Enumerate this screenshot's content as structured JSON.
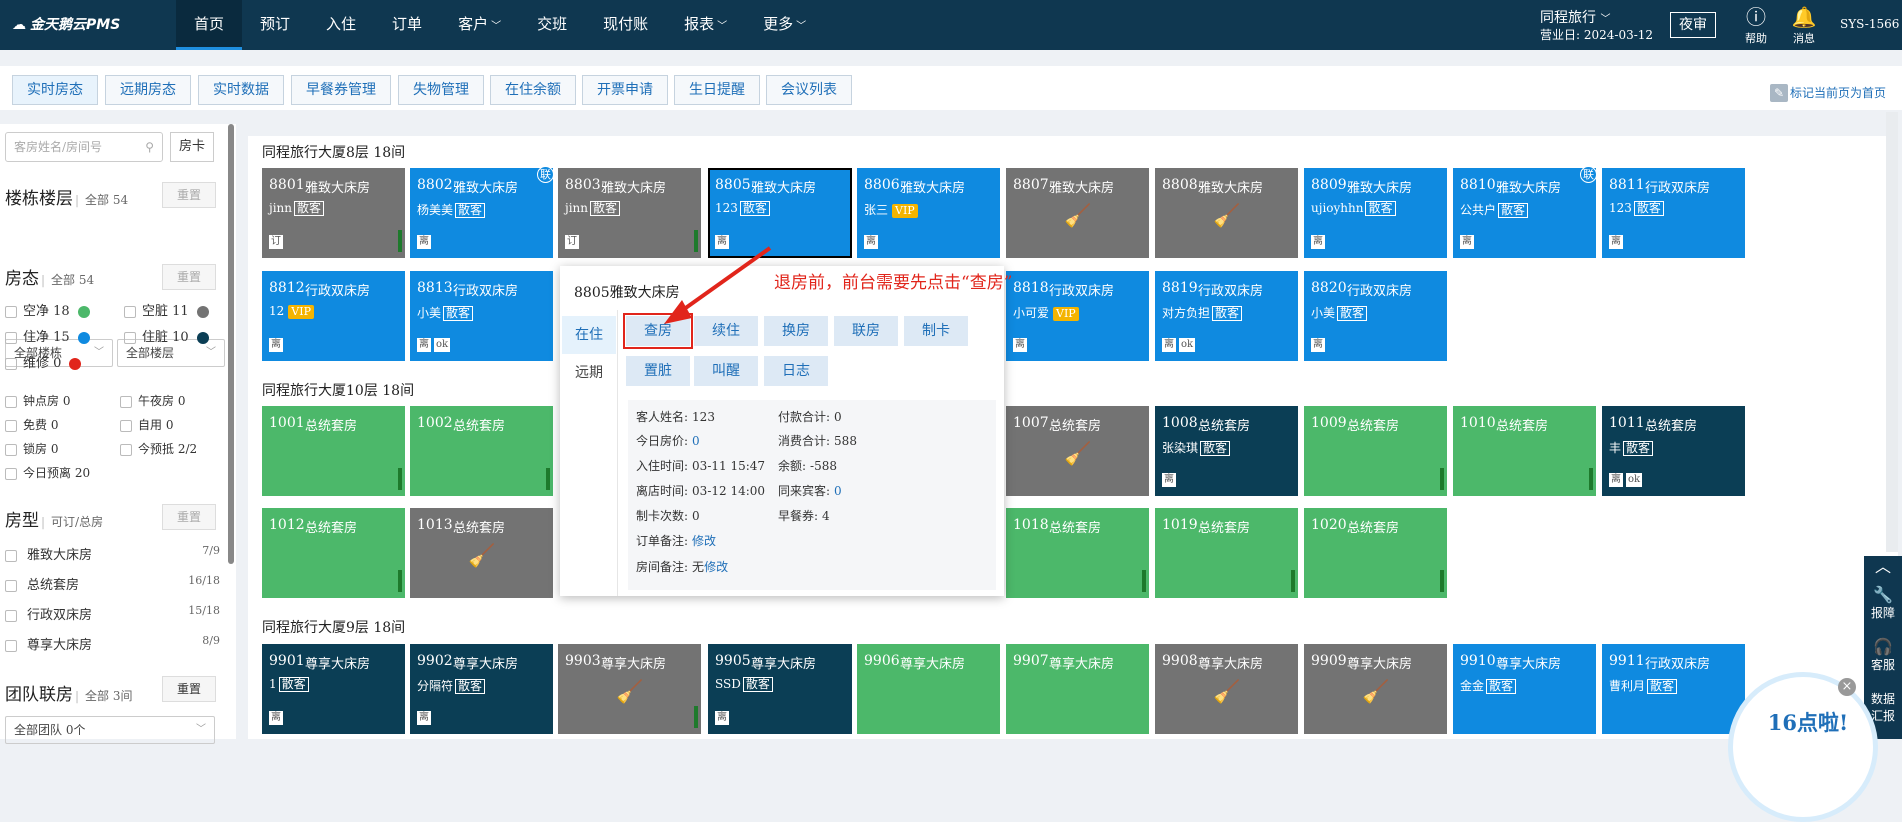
{
  "app": {
    "logo": "金天鹅云PMS"
  },
  "nav": {
    "items": [
      {
        "label": "首页",
        "dropdown": false
      },
      {
        "label": "预订",
        "dropdown": false
      },
      {
        "label": "入住",
        "dropdown": false
      },
      {
        "label": "订单",
        "dropdown": false
      },
      {
        "label": "客户",
        "dropdown": true
      },
      {
        "label": "交班",
        "dropdown": false
      },
      {
        "label": "现付账",
        "dropdown": false
      },
      {
        "label": "报表",
        "dropdown": true
      },
      {
        "label": "更多",
        "dropdown": true
      }
    ],
    "active": 0
  },
  "header": {
    "hotel": "同程旅行",
    "bizdate_label": "营业日:",
    "bizdate": "2024-03-12",
    "night_btn": "夜审",
    "help": "帮助",
    "msg": "消息",
    "sysid": "SYS-1566"
  },
  "tabs": [
    "实时房态",
    "远期房态",
    "实时数据",
    "早餐券管理",
    "失物管理",
    "在住余额",
    "开票申请",
    "生日提醒",
    "会议列表"
  ],
  "mark_home": "标记当前页为首页",
  "sidebar": {
    "search_placeholder": "客房姓名/房间号",
    "card_btn": "房卡",
    "bldg_title": "楼栋楼层",
    "bldg_all": "全部 54",
    "reset": "重置",
    "sel_bldg": "全部楼栋",
    "sel_floor": "全部楼层",
    "status_title": "房态",
    "status_all": "全部 54",
    "statuses": [
      {
        "label": "空净 18",
        "color": "#4cb86a"
      },
      {
        "label": "空脏 11",
        "color": "#737373"
      },
      {
        "label": "住净 15",
        "color": "#0f8ae0"
      },
      {
        "label": "住脏 10",
        "color": "#0b3e55"
      },
      {
        "label": "维修 0",
        "color": "#e1251b"
      }
    ],
    "flags": [
      "钟点房 0",
      "午夜房 0",
      "免费 0",
      "自用 0",
      "锁房 0",
      "今预抵 2/2",
      "今日预离 20"
    ],
    "rt_title": "房型",
    "rt_sub": "可订/总房",
    "roomtypes": [
      {
        "label": "雅致大床房",
        "count": "7/9"
      },
      {
        "label": "总统套房",
        "count": "16/18"
      },
      {
        "label": "行政双床房",
        "count": "15/18"
      },
      {
        "label": "尊享大床房",
        "count": "8/9"
      }
    ],
    "team_title": "团队联房",
    "team_all": "全部 3间",
    "team_sel": "全部团队 0个"
  },
  "floors": [
    {
      "title": "同程旅行大厦8层 18间"
    },
    {
      "title": "同程旅行大厦10层 18间"
    },
    {
      "title": "同程旅行大厦9层 18间"
    }
  ],
  "rooms": {
    "r8801": {
      "num": "8801",
      "type": "雅致大床房",
      "guest": "jinn",
      "gtag": "散客",
      "tag": "订"
    },
    "r8802": {
      "num": "8802",
      "type": "雅致大床房",
      "guest": "杨美美",
      "gtag": "散客",
      "tag": "离",
      "lian": "联"
    },
    "r8803": {
      "num": "8803",
      "type": "雅致大床房",
      "guest": "jinn",
      "gtag": "散客",
      "tag": "订"
    },
    "r8805": {
      "num": "8805",
      "type": "雅致大床房",
      "guest": "123",
      "gtag": "散客",
      "tag": "离"
    },
    "r8806": {
      "num": "8806",
      "type": "雅致大床房",
      "guest": "张三",
      "vip": "VIP",
      "tag": "离"
    },
    "r8807": {
      "num": "8807",
      "type": "雅致大床房"
    },
    "r8808": {
      "num": "8808",
      "type": "雅致大床房"
    },
    "r8809": {
      "num": "8809",
      "type": "雅致大床房",
      "guest": "ujioyhhn",
      "gtag": "散客",
      "tag": "离"
    },
    "r8810": {
      "num": "8810",
      "type": "雅致大床房",
      "guest": "公共户",
      "gtag": "散客",
      "tag": "离",
      "lian": "联"
    },
    "r8811": {
      "num": "8811",
      "type": "行政双床房",
      "guest": "123",
      "gtag": "散客",
      "tag": "离"
    },
    "r8812": {
      "num": "8812",
      "type": "行政双床房",
      "guest": "12",
      "vip": "VIP",
      "tag": "离"
    },
    "r8813": {
      "num": "8813",
      "type": "行政双床房",
      "guest": "小美",
      "gtag": "散客",
      "tag": "离",
      "ok": "ok"
    },
    "r8818": {
      "num": "8818",
      "type": "行政双床房",
      "guest": "小可爱",
      "vip": "VIP",
      "tag": "离"
    },
    "r8819": {
      "num": "8819",
      "type": "行政双床房",
      "guest": "对方负担",
      "gtag": "散客",
      "tag": "离",
      "ok": "ok"
    },
    "r8820": {
      "num": "8820",
      "type": "行政双床房",
      "guest": "小美",
      "gtag": "散客",
      "tag": "离"
    },
    "r1001": {
      "num": "1001",
      "type": "总统套房"
    },
    "r1002": {
      "num": "1002",
      "type": "总统套房"
    },
    "r1007": {
      "num": "1007",
      "type": "总统套房"
    },
    "r1008": {
      "num": "1008",
      "type": "总统套房",
      "guest": "张染琪",
      "gtag": "散客",
      "tag": "离"
    },
    "r1009": {
      "num": "1009",
      "type": "总统套房"
    },
    "r1010": {
      "num": "1010",
      "type": "总统套房"
    },
    "r1011": {
      "num": "1011",
      "type": "总统套房",
      "guest": "丰",
      "gtag": "散客",
      "tag": "离",
      "ok": "ok"
    },
    "r1012": {
      "num": "1012",
      "type": "总统套房"
    },
    "r1013": {
      "num": "1013",
      "type": "总统套房"
    },
    "r1018": {
      "num": "1018",
      "type": "总统套房"
    },
    "r1019": {
      "num": "1019",
      "type": "总统套房"
    },
    "r1020": {
      "num": "1020",
      "type": "总统套房"
    },
    "r9901": {
      "num": "9901",
      "type": "尊享大床房",
      "guest": "1",
      "gtag": "散客",
      "tag": "离"
    },
    "r9902": {
      "num": "9902",
      "type": "尊享大床房",
      "guest": "分隔符",
      "gtag": "散客",
      "tag": "离"
    },
    "r9903": {
      "num": "9903",
      "type": "尊享大床房"
    },
    "r9905": {
      "num": "9905",
      "type": "尊享大床房",
      "guest": "SSD",
      "gtag": "散客",
      "tag": "离"
    },
    "r9906": {
      "num": "9906",
      "type": "尊享大床房"
    },
    "r9907": {
      "num": "9907",
      "type": "尊享大床房"
    },
    "r9908": {
      "num": "9908",
      "type": "尊享大床房"
    },
    "r9909": {
      "num": "9909",
      "type": "尊享大床房"
    },
    "r9910": {
      "num": "9910",
      "type": "尊享大床房",
      "guest": "金金",
      "gtag": "散客"
    },
    "r9911": {
      "num": "9911",
      "type": "行政双床房",
      "guest": "曹利月",
      "gtag": "散客"
    }
  },
  "popup": {
    "title": "8805雅致大床房",
    "side_tabs": [
      "在住",
      "远期"
    ],
    "buttons": [
      "查房",
      "续住",
      "换房",
      "联房",
      "制卡",
      "置脏",
      "叫醒",
      "日志"
    ],
    "info": {
      "guest_l": "客人姓名:",
      "guest_v": "123",
      "pay_l": "付款合计:",
      "pay_v": "0",
      "price_l": "今日房价:",
      "price_v": "0",
      "cons_l": "消费合计:",
      "cons_v": "588",
      "in_l": "入住时间:",
      "in_v": "03-11 15:47",
      "bal_l": "余额:",
      "bal_v": "-588",
      "out_l": "离店时间:",
      "out_v": "03-12 14:00",
      "comp_l": "同来宾客:",
      "comp_v": "0",
      "card_l": "制卡次数:",
      "card_v": "0",
      "bf_l": "早餐券:",
      "bf_v": "4",
      "onote_l": "订单备注:",
      "onote_v": "修改",
      "rnote_l": "房间备注:",
      "rnote_pre": "无",
      "rnote_v": "修改"
    }
  },
  "annotation": "退房前，前台需要先点击“查房”",
  "dock": {
    "items": [
      "报障",
      "客服",
      "数据汇报"
    ]
  },
  "promo": "16点啦!",
  "colors": {
    "green": "#4cb86a",
    "blue": "#0f8ae0",
    "gray": "#737373",
    "navy": "#0b3e55",
    "header": "#0f3750",
    "red": "#e1251b"
  }
}
